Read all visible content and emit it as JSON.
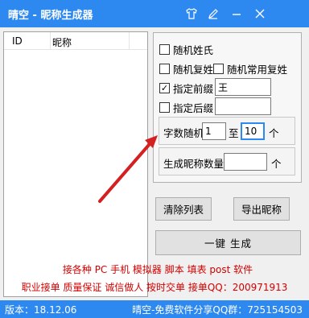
{
  "window": {
    "title": "晴空 - 昵称生成器",
    "icons": [
      "shirt-icon",
      "edit-icon",
      "minimize-icon",
      "close-icon"
    ]
  },
  "list": {
    "col_id": "ID",
    "col_name": "昵称"
  },
  "options": {
    "random_surname": "随机姓氏",
    "random_compound_surname": "随机复姓",
    "random_common_compound": "随机常用复姓",
    "prefix_label": "指定前缀",
    "prefix_value": "王",
    "suffix_label": "指定后缀",
    "suffix_value": "",
    "word_count_label": "字数随机",
    "word_count_from": "1",
    "word_count_to_label": "至",
    "word_count_to": "10",
    "word_count_unit": "个",
    "gen_count_label": "生成昵称数量",
    "gen_count_value": "",
    "gen_count_unit": "个"
  },
  "buttons": {
    "clear": "清除列表",
    "export": "导出昵称",
    "generate": "一键 生成"
  },
  "promo": {
    "line1": "接各种 PC 手机 模拟器 脚本 填表 post 软件",
    "line2": "职业接单 质量保证 诚信做人 按时交单 接单QQ：200971913"
  },
  "status": {
    "version": "版本：18.12.06",
    "share": "晴空-免费软件分享QQ群：725154503"
  },
  "colors": {
    "titlebar": "#2d89ef",
    "promo": "#d40000",
    "arrow": "#d42020"
  }
}
